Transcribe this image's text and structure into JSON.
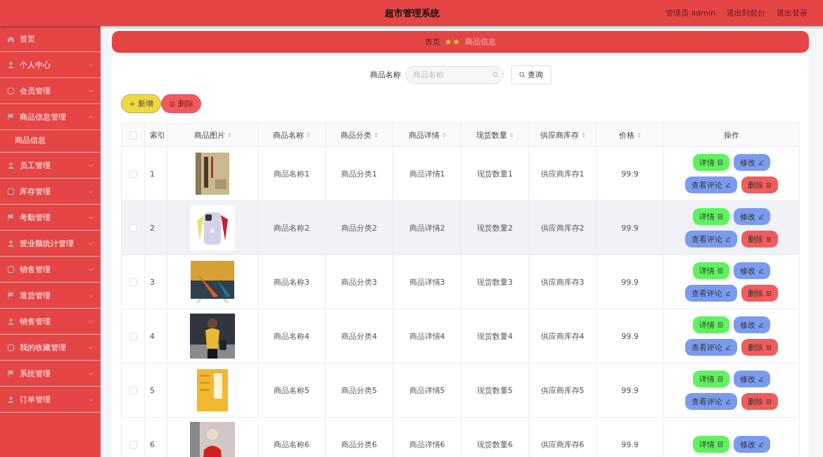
{
  "header": {
    "title": "超市管理系统",
    "links": [
      "管理员 admin",
      "退出到前台",
      "退出登录"
    ]
  },
  "sidebar": {
    "items": [
      {
        "label": "首页"
      },
      {
        "label": "个人中心",
        "expanded": false
      },
      {
        "label": "会员管理",
        "expanded": false
      },
      {
        "label": "商品信息管理",
        "expanded": true,
        "children": [
          {
            "label": "商品信息"
          }
        ]
      },
      {
        "label": "员工管理",
        "expanded": false
      },
      {
        "label": "库存管理",
        "expanded": false
      },
      {
        "label": "考勤管理",
        "expanded": false
      },
      {
        "label": "营业额统计管理",
        "expanded": false
      },
      {
        "label": "销售管理",
        "expanded": false
      },
      {
        "label": "退货管理",
        "expanded": false
      },
      {
        "label": "销售管理",
        "expanded": false
      },
      {
        "label": "我的收藏管理",
        "expanded": false
      },
      {
        "label": "系统管理",
        "expanded": false
      },
      {
        "label": "订单管理",
        "expanded": false
      }
    ]
  },
  "breadcrumb": [
    {
      "label": "首页",
      "current": false
    },
    {
      "label": "商品信息",
      "current": true
    }
  ],
  "search": {
    "label": "商品名称",
    "placeholder": "商品名称",
    "button": "查询"
  },
  "toolbar": [
    {
      "kind": "add",
      "label": "新增"
    },
    {
      "kind": "delete",
      "label": "删除"
    }
  ],
  "table": {
    "select_all_checked": false,
    "columns": [
      {
        "label": "索引",
        "sortable": false
      },
      {
        "label": "商品图片",
        "sortable": true
      },
      {
        "label": "商品名称",
        "sortable": true
      },
      {
        "label": "商品分类",
        "sortable": true
      },
      {
        "label": "商品详情",
        "sortable": true
      },
      {
        "label": "现货数量",
        "sortable": true
      },
      {
        "label": "供应商库存",
        "sortable": true
      },
      {
        "label": "价格",
        "sortable": true
      },
      {
        "label": "操作",
        "sortable": false
      }
    ],
    "rows": [
      {
        "checked": false,
        "selected": false,
        "index": "1",
        "name": "商品名称1",
        "category": "商品分类1",
        "detail": "商品详情1",
        "stock": "现货数量1",
        "supplier": "供应商库存1",
        "price": "99.9",
        "actions": [
          {
            "kind": "detail",
            "label": "详情"
          },
          {
            "kind": "edit",
            "label": "修改"
          },
          {
            "kind": "comments",
            "label": "查看评论"
          },
          {
            "kind": "delete",
            "label": "删除"
          }
        ]
      },
      {
        "checked": false,
        "selected": true,
        "index": "2",
        "name": "商品名称2",
        "category": "商品分类2",
        "detail": "商品详情2",
        "stock": "现货数量2",
        "supplier": "供应商库存2",
        "price": "99.9",
        "actions": [
          {
            "kind": "detail",
            "label": "详情"
          },
          {
            "kind": "edit",
            "label": "修改"
          },
          {
            "kind": "comments",
            "label": "查看评论"
          },
          {
            "kind": "delete",
            "label": "删除"
          }
        ]
      },
      {
        "checked": false,
        "selected": false,
        "index": "3",
        "name": "商品名称3",
        "category": "商品分类3",
        "detail": "商品详情3",
        "stock": "现货数量3",
        "supplier": "供应商库存3",
        "price": "99.9",
        "actions": [
          {
            "kind": "detail",
            "label": "详情"
          },
          {
            "kind": "edit",
            "label": "修改"
          },
          {
            "kind": "comments",
            "label": "查看评论"
          },
          {
            "kind": "delete",
            "label": "删除"
          }
        ]
      },
      {
        "checked": false,
        "selected": false,
        "index": "4",
        "name": "商品名称4",
        "category": "商品分类4",
        "detail": "商品详情4",
        "stock": "现货数量4",
        "supplier": "供应商库存4",
        "price": "99.9",
        "actions": [
          {
            "kind": "detail",
            "label": "详情"
          },
          {
            "kind": "edit",
            "label": "修改"
          },
          {
            "kind": "comments",
            "label": "查看评论"
          },
          {
            "kind": "delete",
            "label": "删除"
          }
        ]
      },
      {
        "checked": false,
        "selected": false,
        "index": "5",
        "name": "商品名称5",
        "category": "商品分类5",
        "detail": "商品详情5",
        "stock": "现货数量5",
        "supplier": "供应商库存5",
        "price": "99.9",
        "actions": [
          {
            "kind": "detail",
            "label": "详情"
          },
          {
            "kind": "edit",
            "label": "修改"
          },
          {
            "kind": "comments",
            "label": "查看评论"
          },
          {
            "kind": "delete",
            "label": "删除"
          }
        ]
      },
      {
        "checked": false,
        "selected": false,
        "index": "6",
        "name": "商品名称6",
        "category": "商品分类6",
        "detail": "商品详情6",
        "stock": "现货数量6",
        "supplier": "供应商库存6",
        "price": "99.9",
        "actions": [
          {
            "kind": "detail",
            "label": "详情"
          },
          {
            "kind": "edit",
            "label": "修改"
          }
        ]
      }
    ]
  }
}
